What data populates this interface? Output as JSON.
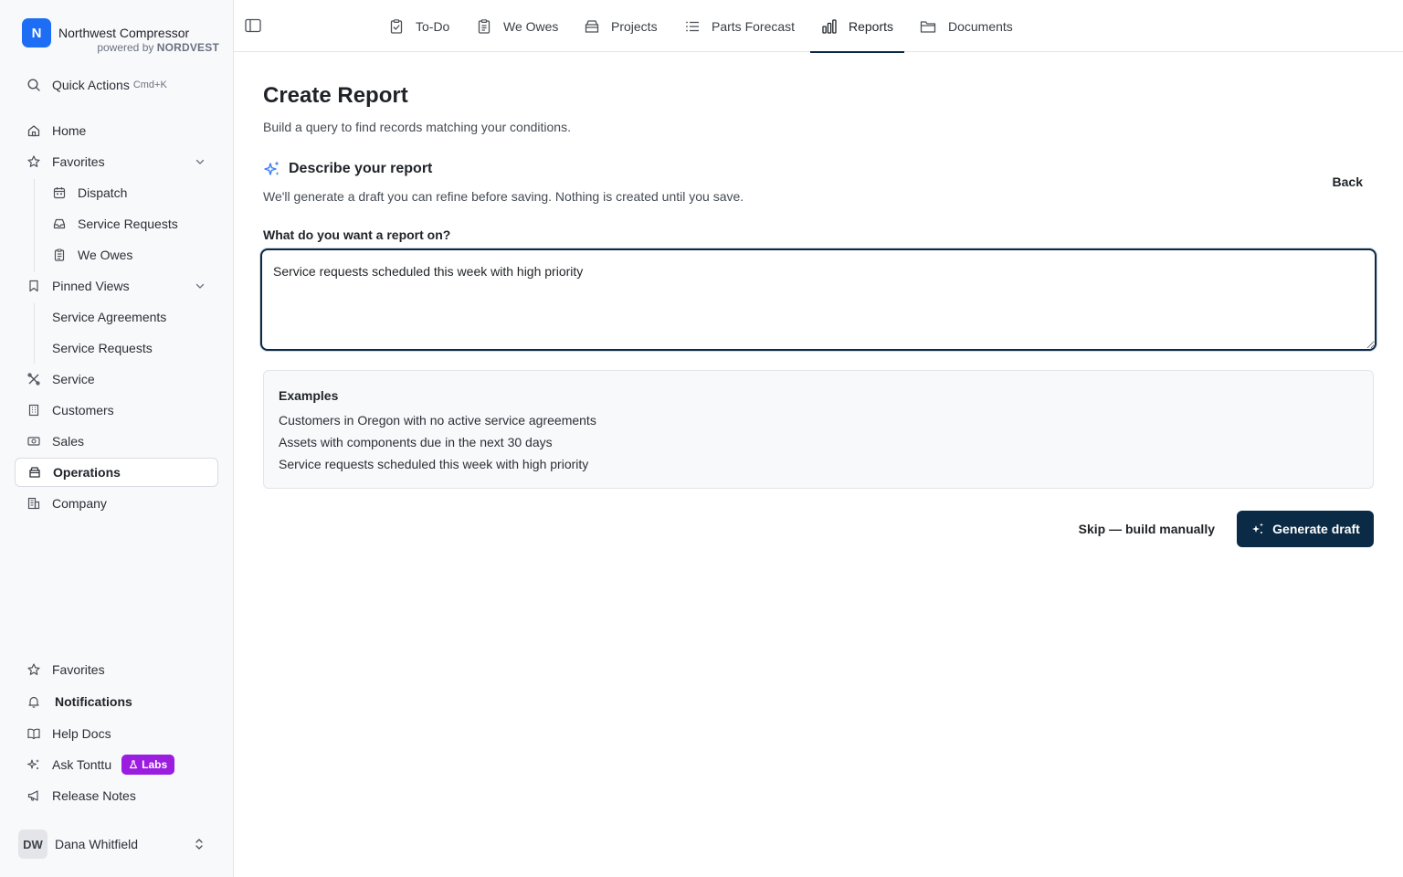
{
  "brand": {
    "logo_letter": "N",
    "name": "Northwest Compressor",
    "powered_by": "powered by",
    "powered_brand": "NORDVEST"
  },
  "sidebar": {
    "quick_actions": {
      "label": "Quick Actions",
      "shortcut": "Cmd+K"
    },
    "items": {
      "home": "Home",
      "favorites": "Favorites",
      "dispatch": "Dispatch",
      "service_requests_fav": "Service Requests",
      "we_owes": "We Owes",
      "pinned_views": "Pinned Views",
      "service_agreements": "Service Agreements",
      "service_requests_pin": "Service Requests",
      "service": "Service",
      "customers": "Customers",
      "sales": "Sales",
      "operations": "Operations",
      "company": "Company"
    },
    "active": "Operations",
    "bottom": {
      "favorites": "Favorites",
      "notifications": "Notifications",
      "help_docs": "Help Docs",
      "ask_tonttu": "Ask Tonttu",
      "labs_badge": "Labs",
      "release_notes": "Release Notes"
    },
    "user": {
      "initials": "DW",
      "name": "Dana Whitfield"
    }
  },
  "tabs": [
    {
      "label": "To-Do",
      "icon": "clipboard-check-icon"
    },
    {
      "label": "We Owes",
      "icon": "clipboard-list-icon"
    },
    {
      "label": "Projects",
      "icon": "archive-icon"
    },
    {
      "label": "Parts Forecast",
      "icon": "list-icon"
    },
    {
      "label": "Reports",
      "icon": "bar-chart-icon",
      "active": true
    },
    {
      "label": "Documents",
      "icon": "folder-icon"
    }
  ],
  "page": {
    "title": "Create Report",
    "subtitle": "Build a query to find records matching your conditions.",
    "section_title": "Describe your report",
    "section_desc": "We'll generate a draft you can refine before saving. Nothing is created until you save.",
    "back_label": "Back",
    "field_label": "What do you want a report on?",
    "query_value": "Service requests scheduled this week with high priority",
    "examples_title": "Examples",
    "examples": [
      "Customers in Oregon with no active service agreements",
      "Assets with components due in the next 30 days",
      "Service requests scheduled this week with high priority"
    ],
    "skip_label": "Skip — build manually",
    "generate_label": "Generate draft"
  },
  "colors": {
    "brand_blue": "#1d6ef5",
    "primary_navy": "#0b2a45",
    "labs_purple": "#9b1de0",
    "sparkle_blue": "#3b7cf6"
  }
}
